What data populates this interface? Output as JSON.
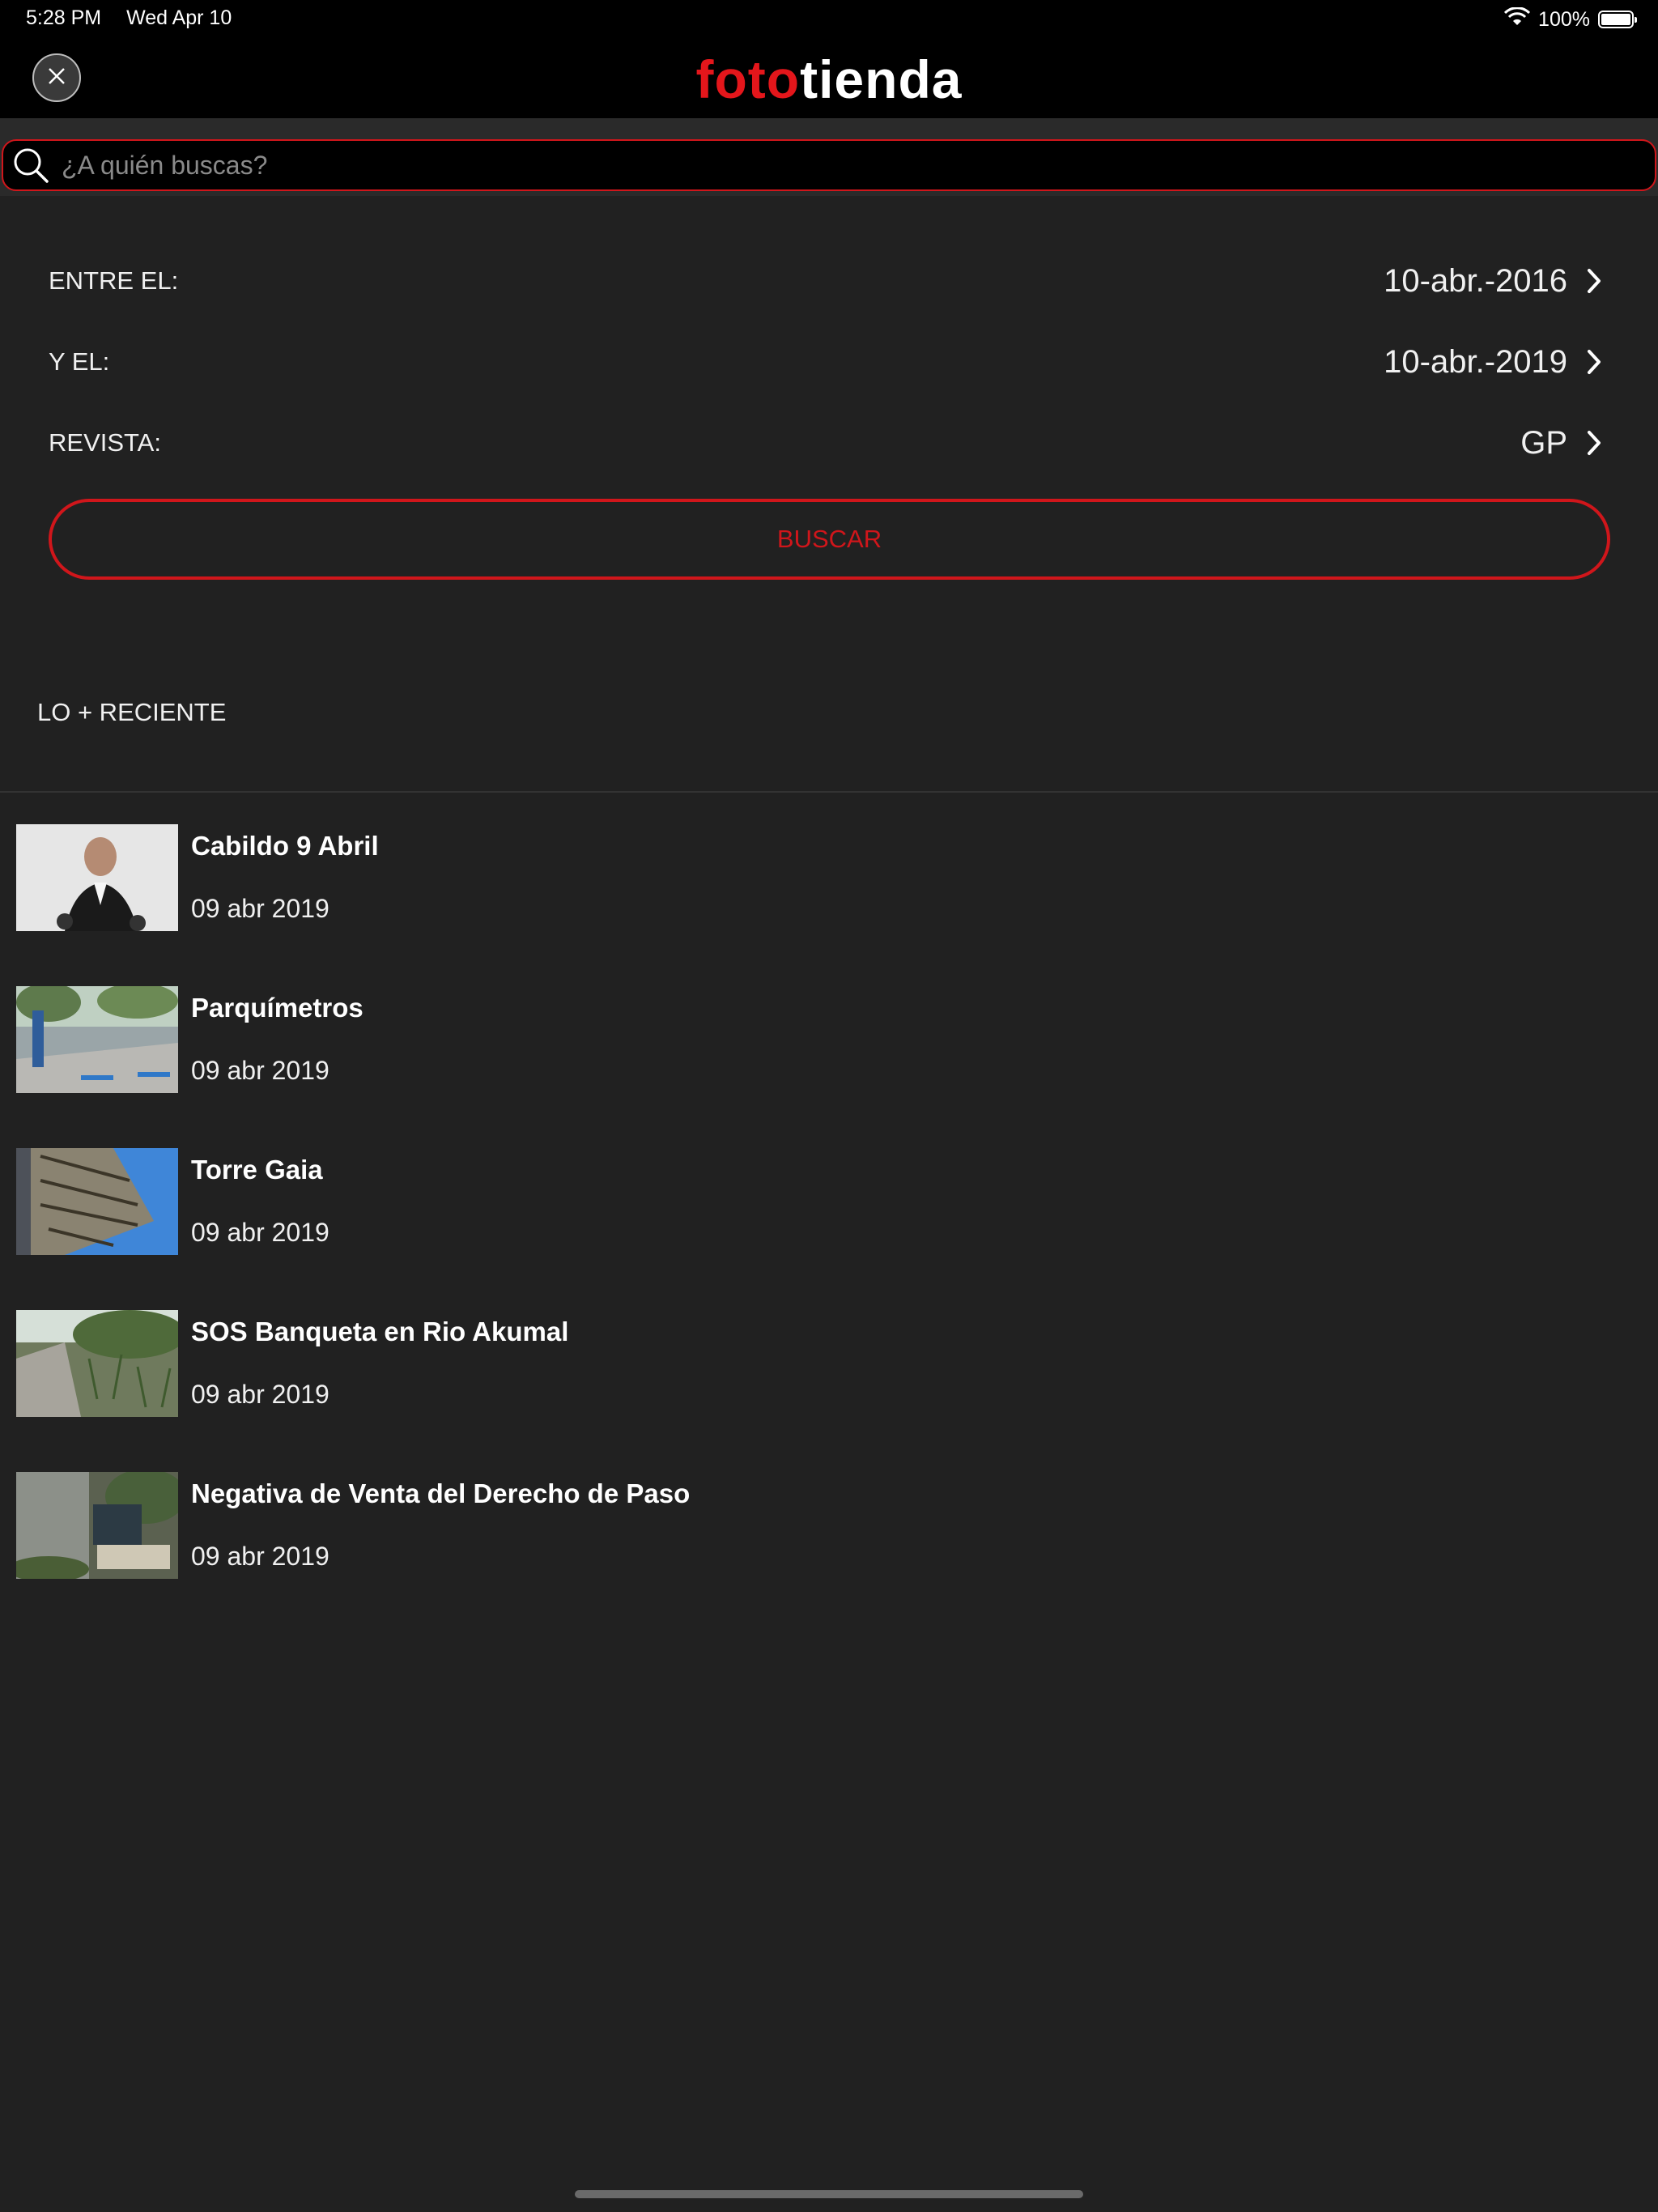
{
  "status_bar": {
    "time": "5:28 PM",
    "date": "Wed Apr 10",
    "battery_percent": "100%",
    "battery_level": 1.0,
    "icons": [
      "wifi-icon",
      "battery-icon"
    ]
  },
  "header": {
    "logo_part1": "foto",
    "logo_part2": "tienda",
    "close_icon": "close-icon",
    "colors": {
      "brand_red": "#e4161b",
      "background": "#000000"
    }
  },
  "search": {
    "placeholder": "¿A quién buscas?",
    "value": "",
    "icon": "search-icon"
  },
  "filters": [
    {
      "label": "ENTRE EL:",
      "value": "10-abr.-2016"
    },
    {
      "label": "Y EL:",
      "value": "10-abr.-2019"
    },
    {
      "label": "REVISTA:",
      "value": "GP"
    }
  ],
  "buscar_label": "BUSCAR",
  "section_title": "LO + RECIENTE",
  "recent_items": [
    {
      "title": "Cabildo 9 Abril",
      "date": "09 abr 2019"
    },
    {
      "title": "Parquímetros",
      "date": "09 abr 2019"
    },
    {
      "title": "Torre Gaia",
      "date": "09 abr 2019"
    },
    {
      "title": "SOS Banqueta en Rio Akumal",
      "date": "09 abr 2019"
    },
    {
      "title": "Negativa de Venta del Derecho de Paso",
      "date": "09 abr 2019"
    }
  ],
  "colors": {
    "accent": "#d0161b",
    "page_bg": "#212121"
  }
}
